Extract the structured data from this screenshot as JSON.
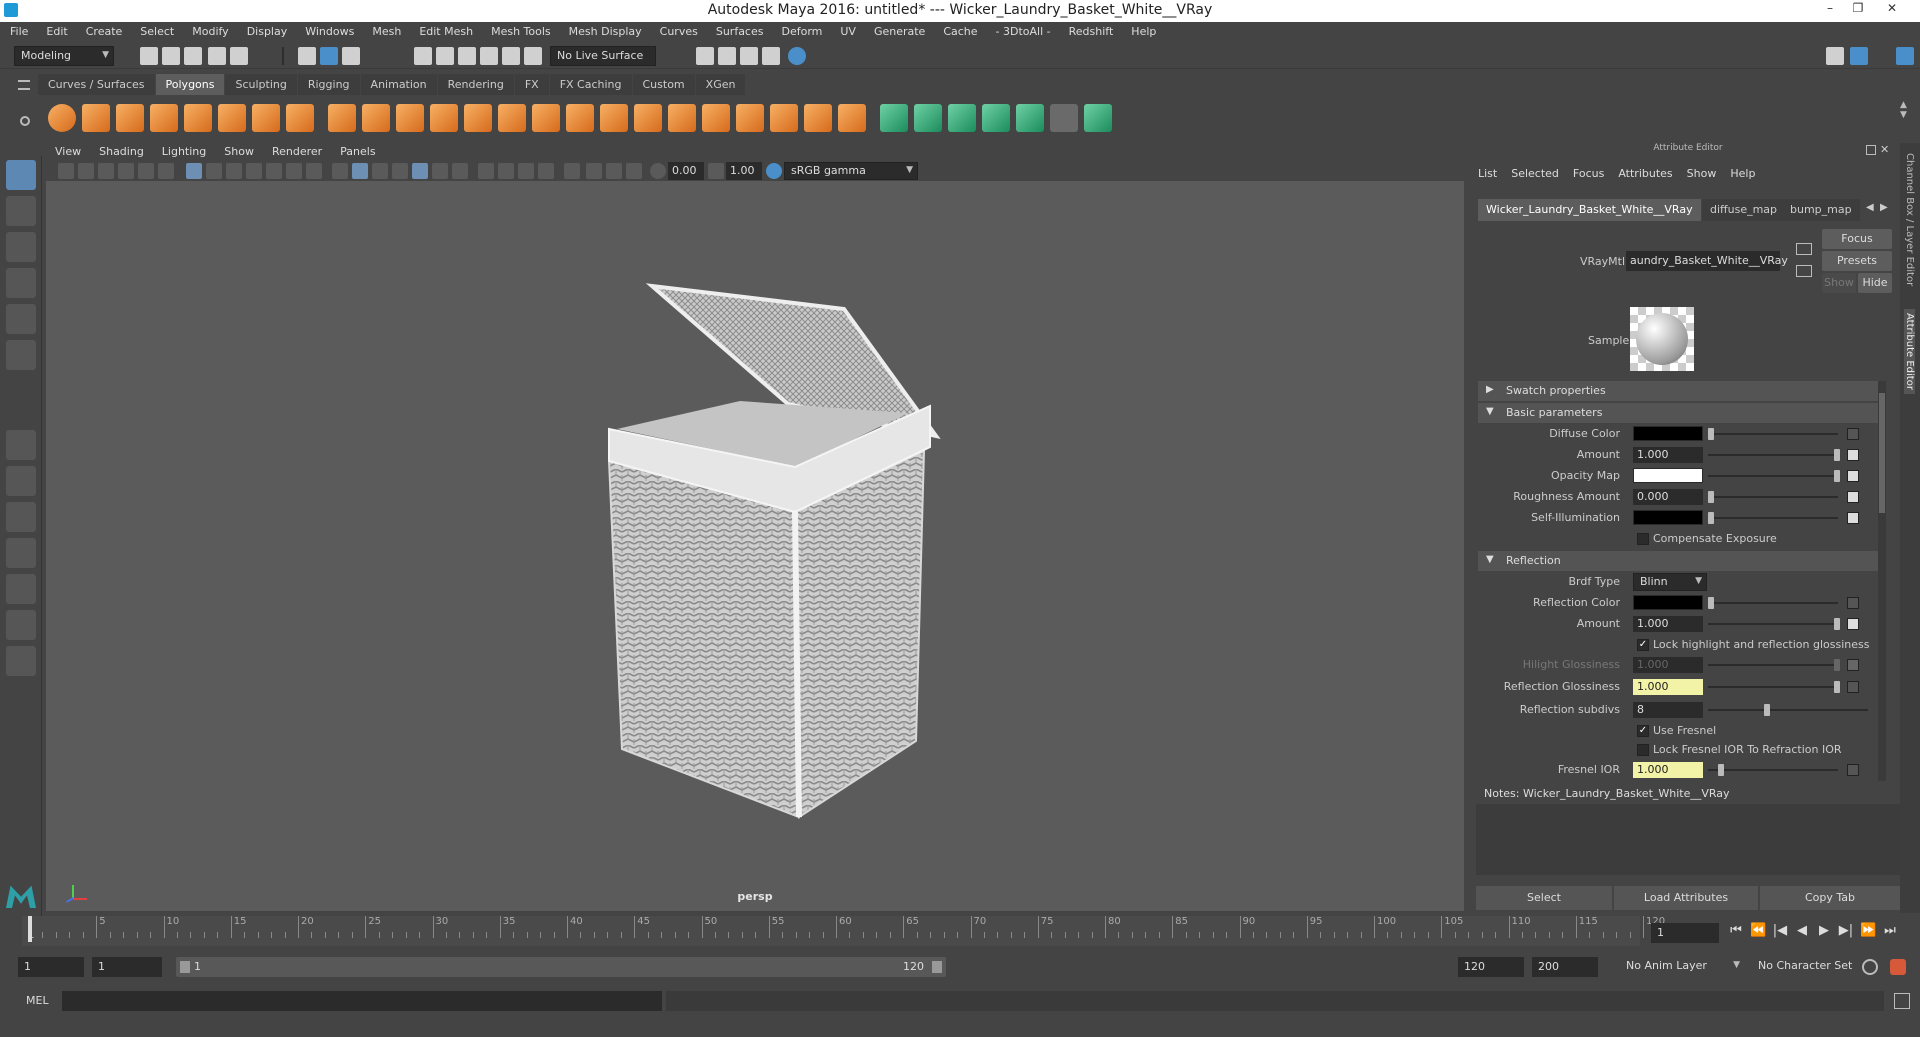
{
  "title_bar": {
    "title": "Autodesk Maya 2016: untitled*   ---   Wicker_Laundry_Basket_White__VRay",
    "minimize": "–",
    "restore": "❐",
    "close": "✕"
  },
  "menubar": [
    "File",
    "Edit",
    "Create",
    "Select",
    "Modify",
    "Display",
    "Windows",
    "Mesh",
    "Edit Mesh",
    "Mesh Tools",
    "Mesh Display",
    "Curves",
    "Surfaces",
    "Deform",
    "UV",
    "Generate",
    "Cache",
    "- 3DtoAll -",
    "Redshift",
    "Help"
  ],
  "status_line": {
    "menuset": "Modeling",
    "live_surface": "No Live Surface"
  },
  "shelf_tabs": [
    "Curves / Surfaces",
    "Polygons",
    "Sculpting",
    "Rigging",
    "Animation",
    "Rendering",
    "FX",
    "FX Caching",
    "Custom",
    "XGen"
  ],
  "shelf_active": "Polygons",
  "viewport": {
    "menu": [
      "View",
      "Shading",
      "Lighting",
      "Show",
      "Renderer",
      "Panels"
    ],
    "exposure": "0.00",
    "gamma": "1.00",
    "color_space": "sRGB gamma",
    "camera_label": "persp"
  },
  "attribute_editor": {
    "header": "Attribute Editor",
    "menu": [
      "List",
      "Selected",
      "Focus",
      "Attributes",
      "Show",
      "Help"
    ],
    "tabs": [
      "Wicker_Laundry_Basket_White__VRay",
      "diffuse_map",
      "bump_map"
    ],
    "buttons": {
      "focus": "Focus",
      "presets": "Presets",
      "show": "Show",
      "hide": "Hide"
    },
    "material_label": "VRayMtl:",
    "material_name": "aundry_Basket_White__VRay",
    "sample_label": "Sample",
    "sections": {
      "swatch": "Swatch properties",
      "basic": "Basic parameters",
      "reflection": "Reflection"
    },
    "basic": {
      "diffuse_color": "Diffuse Color",
      "amount_label": "Amount",
      "amount": "1.000",
      "opacity_map": "Opacity Map",
      "roughness_label": "Roughness Amount",
      "roughness": "0.000",
      "self_illum": "Self-Illumination",
      "compensate": "Compensate Exposure"
    },
    "reflection": {
      "brdf_label": "Brdf Type",
      "brdf": "Blinn",
      "refl_color": "Reflection Color",
      "amount_label": "Amount",
      "amount": "1.000",
      "lock_highlight": "Lock highlight and reflection glossiness",
      "hilight_label": "Hilight Glossiness",
      "hilight": "1.000",
      "refl_gloss_label": "Reflection Glossiness",
      "refl_gloss": "1.000",
      "refl_subdivs_label": "Reflection subdivs",
      "refl_subdivs": "8",
      "use_fresnel": "Use Fresnel",
      "lock_fresnel": "Lock Fresnel IOR To Refraction IOR",
      "fresnel_ior_label": "Fresnel IOR",
      "fresnel_ior": "1.000"
    },
    "notes": "Notes:  Wicker_Laundry_Basket_White__VRay",
    "bottom_buttons": [
      "Select",
      "Load Attributes",
      "Copy Tab"
    ]
  },
  "side_tabs": [
    "Channel Box / Layer Editor",
    "Attribute Editor"
  ],
  "timeline": {
    "ticks": [
      "5",
      "10",
      "15",
      "20",
      "25",
      "30",
      "35",
      "40",
      "45",
      "50",
      "55",
      "60",
      "65",
      "70",
      "75",
      "80",
      "85",
      "90",
      "95",
      "100",
      "105",
      "110",
      "115",
      "120"
    ],
    "start_label": "1",
    "current_frame": "1"
  },
  "range": {
    "start": "1",
    "start_inner": "1",
    "slider_start": "1",
    "slider_end": "120",
    "end_inner": "120",
    "end": "200",
    "anim_layer": "No Anim Layer",
    "character_set": "No Character Set"
  },
  "command_line": {
    "lang": "MEL"
  }
}
